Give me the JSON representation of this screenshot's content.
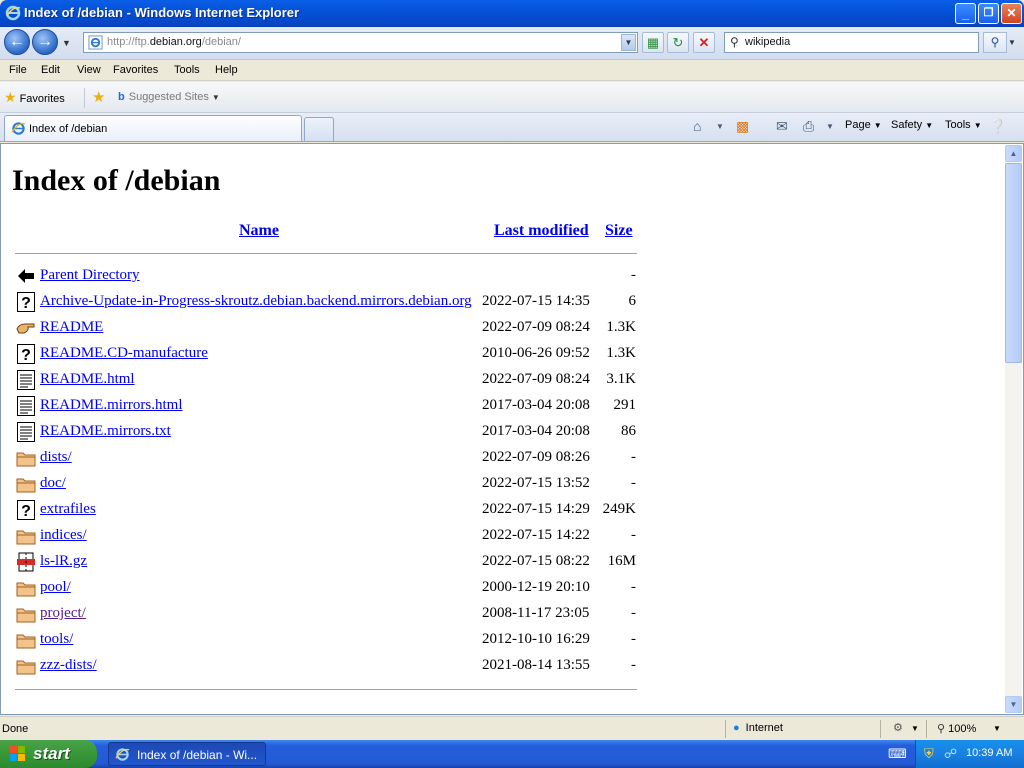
{
  "window": {
    "title": "Index of /debian - Windows Internet Explorer",
    "minimize": "_",
    "maximize": "❐",
    "close": "✕"
  },
  "address": {
    "prefix": "http://ftp.",
    "host": "debian.org",
    "path": "/debian/",
    "search_value": "wikipedia"
  },
  "menu": [
    "File",
    "Edit",
    "View",
    "Favorites",
    "Tools",
    "Help"
  ],
  "favorites_bar": {
    "favorites_label": "Favorites",
    "suggested_label": "Suggested Sites"
  },
  "tab": {
    "title": "Index of /debian"
  },
  "command_bar": {
    "page": "Page",
    "safety": "Safety",
    "tools": "Tools"
  },
  "page": {
    "heading": "Index of /debian",
    "columns": {
      "name": "Name",
      "modified": "Last modified",
      "size": "Size"
    },
    "rows": [
      {
        "icon": "back-icon",
        "name": "Parent Directory",
        "modified": "",
        "size": "-"
      },
      {
        "icon": "unknown-file-icon",
        "name": "Archive-Update-in-Progress-skroutz.debian.backend.mirrors.debian.org",
        "modified": "2022-07-15 14:35",
        "size": "6"
      },
      {
        "icon": "readme-hand-icon",
        "name": "README",
        "modified": "2022-07-09 08:24",
        "size": "1.3K"
      },
      {
        "icon": "unknown-file-icon",
        "name": "README.CD-manufacture",
        "modified": "2010-06-26 09:52",
        "size": "1.3K"
      },
      {
        "icon": "text-file-icon",
        "name": "README.html",
        "modified": "2022-07-09 08:24",
        "size": "3.1K"
      },
      {
        "icon": "text-file-icon",
        "name": "README.mirrors.html",
        "modified": "2017-03-04 20:08",
        "size": "291"
      },
      {
        "icon": "text-file-icon",
        "name": "README.mirrors.txt",
        "modified": "2017-03-04 20:08",
        "size": "86"
      },
      {
        "icon": "folder-icon",
        "name": "dists/",
        "modified": "2022-07-09 08:26",
        "size": "-"
      },
      {
        "icon": "folder-icon",
        "name": "doc/",
        "modified": "2022-07-15 13:52",
        "size": "-"
      },
      {
        "icon": "unknown-file-icon",
        "name": "extrafiles",
        "modified": "2022-07-15 14:29",
        "size": "249K"
      },
      {
        "icon": "folder-icon",
        "name": "indices/",
        "modified": "2022-07-15 14:22",
        "size": "-"
      },
      {
        "icon": "compressed-file-icon",
        "name": "ls-lR.gz",
        "modified": "2022-07-15 08:22",
        "size": "16M"
      },
      {
        "icon": "folder-icon",
        "name": "pool/",
        "modified": "2000-12-19 20:10",
        "size": "-"
      },
      {
        "icon": "folder-icon",
        "name": "project/",
        "modified": "2008-11-17 23:05",
        "size": "-",
        "visited": true
      },
      {
        "icon": "folder-icon",
        "name": "tools/",
        "modified": "2012-10-10 16:29",
        "size": "-"
      },
      {
        "icon": "folder-icon",
        "name": "zzz-dists/",
        "modified": "2021-08-14 13:55",
        "size": "-"
      }
    ]
  },
  "status": {
    "text": "Done",
    "zone": "Internet",
    "zoom": "100%"
  },
  "taskbar": {
    "start": "start",
    "task_label": "Index of /debian - Wi...",
    "clock": "10:39 AM"
  },
  "colors": {
    "link": "#0000ee",
    "visited": "#551a8b",
    "titlebar": "#0450d6",
    "start_green": "#3a9a3a"
  }
}
